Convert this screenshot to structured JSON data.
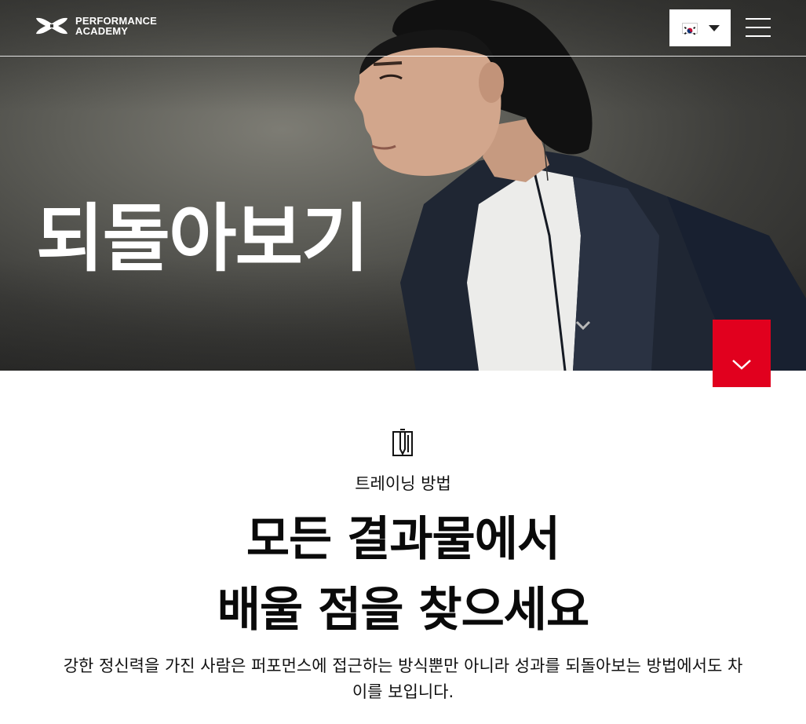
{
  "header": {
    "logo_line1": "PERFORMANCE",
    "logo_line2": "ACADEMY",
    "language_flag": "korea-flag-icon",
    "language_caret": "caret-down-icon",
    "menu_icon": "hamburger-menu-icon"
  },
  "hero": {
    "title": "되돌아보기",
    "scroll_icon": "chevron-down-icon"
  },
  "content": {
    "icon": "notebook-pen-icon",
    "eyebrow": "트레이닝 방법",
    "headline_line1": "모든 결과물에서",
    "headline_line2": "배울 점을 찾으세요",
    "body": "강한 정신력을 가진 사람은 퍼포먼스에 접근하는 방식뿐만 아니라 성과를 되돌아보는 방법에서도 차이를 보입니다."
  },
  "colors": {
    "accent": "#e1001e",
    "text": "#111111",
    "background": "#ffffff"
  }
}
